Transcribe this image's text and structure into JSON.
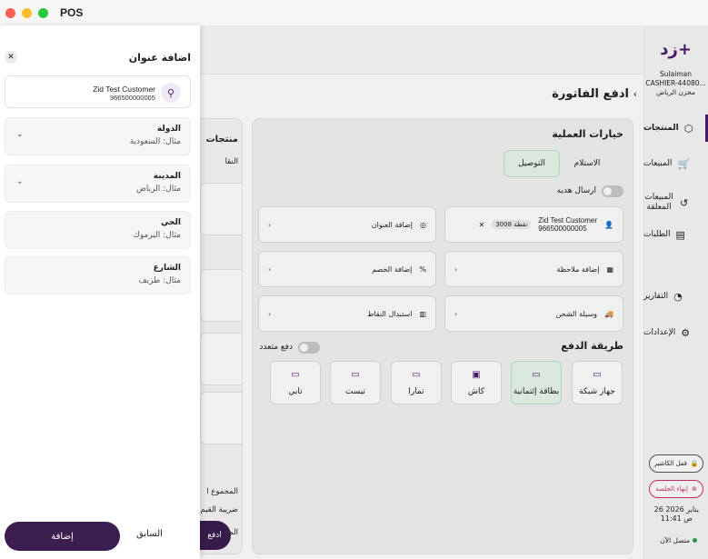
{
  "window": {
    "title": "POS"
  },
  "sidebar": {
    "logo": "زد+",
    "user_name": "Sulaiman",
    "cashier_id": "CASHIER-44080...",
    "store": "مخزن الرياض",
    "items": [
      {
        "label": "المنتجات",
        "icon": "box-icon"
      },
      {
        "label": "المبيعات",
        "icon": "cart-icon"
      },
      {
        "label": "المبيعات المعلقة",
        "icon": "history-icon"
      },
      {
        "label": "الطلبات",
        "icon": "receipt-icon"
      },
      {
        "label": "التقارير",
        "icon": "chart-icon"
      },
      {
        "label": "الإعدادات",
        "icon": "gear-icon"
      }
    ],
    "close_drawer": "قفل الكاشير",
    "end_session": "إنهاء الجلسة",
    "date": "26 يناير 2026",
    "time": "11:41 ص",
    "status": "متصل الآن"
  },
  "invoice": {
    "title": "ادفع الفاتورة",
    "options_title": "خيارات العملية",
    "delivery": "التوصيل",
    "pickup": "الاستلام",
    "send_gift": "ارسال هديه",
    "customer_name": "Zid Test Customer",
    "customer_phone": "966500000005",
    "points_badge": "نقطة 3008",
    "add_address": "إضافة العنوان",
    "add_note": "إضافة ملاحظة",
    "add_discount": "إضافة الخصم",
    "shipping": "وسيلة الشحن",
    "redeem_points": "استبدال النقاط",
    "payment_title": "طريقة الدفع",
    "multi_pay": "دفع متعدد",
    "payment_methods": [
      "جهاز شبكة",
      "بطاقة إئتمانية",
      "كاش",
      "تمارا",
      "تيست",
      "تابي"
    ]
  },
  "products_panel": {
    "title": "منتجات",
    "subtitle": "النقا",
    "total": "المجموع ا",
    "tax": "ضريبة القيم",
    "grand_total": "المجموع",
    "pay_button": "ادفع"
  },
  "drawer": {
    "title": "اضافة عنوان",
    "customer_name": "Zid Test Customer",
    "customer_phone": "966500000005",
    "fields": [
      {
        "label": "الدولة",
        "placeholder": "مثال: السعودية",
        "dropdown": true
      },
      {
        "label": "المدينة",
        "placeholder": "مثال: الرياض",
        "dropdown": true
      },
      {
        "label": "الحي",
        "placeholder": "مثال: اليرموك",
        "dropdown": false
      },
      {
        "label": "الشارع",
        "placeholder": "مثال: طريف",
        "dropdown": false
      }
    ],
    "previous": "السابق",
    "add": "إضافة"
  },
  "colors": {
    "brand": "#3b1d4f",
    "selected_pay": "#e9f7ec",
    "danger": "#d32f5f",
    "online": "#2e9e58"
  }
}
